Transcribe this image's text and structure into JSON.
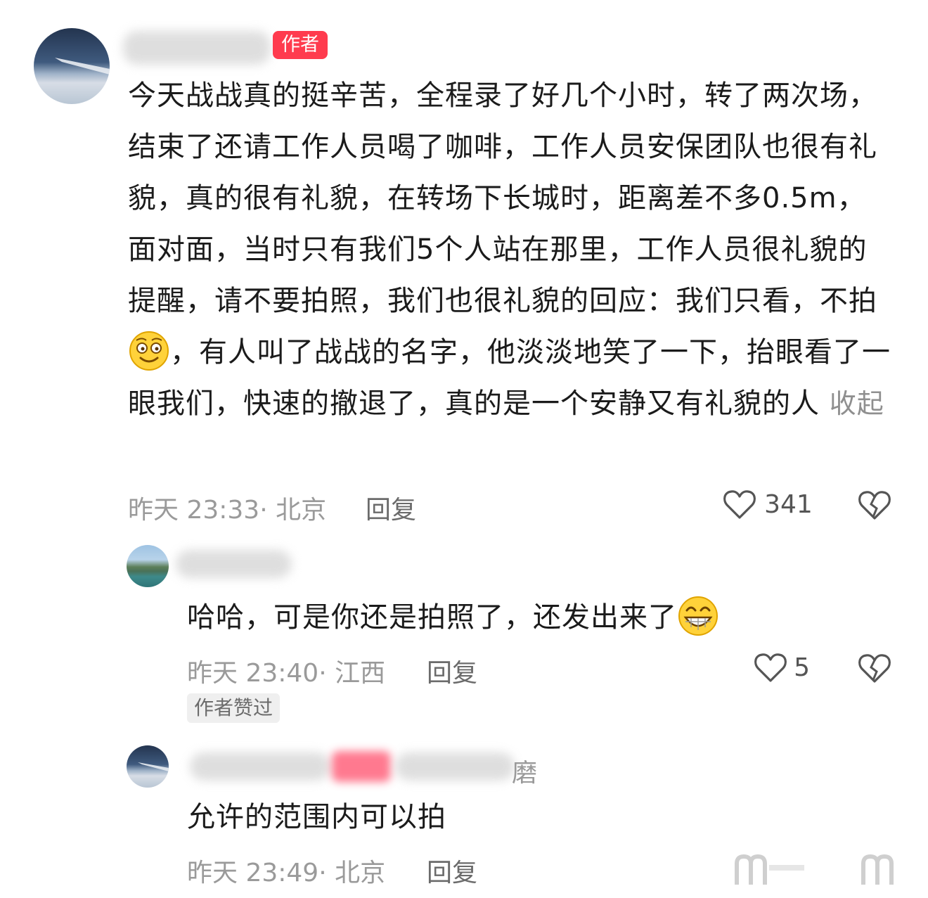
{
  "comment1": {
    "author_tag": "作者",
    "text_part1": "今天战战真的挺辛苦，全程录了好几个小时，转了两次场，结束了还请工作人员喝了咖啡，工作人员安保团队也很有礼貌，真的很有礼貌，在转场下长城时，距离差不多0.5m，面对面，当时只有我们5个人站在那里，工作人员很礼貌的提醒，请不要拍照，我们也很礼貌的回应：我们只看，不拍",
    "emoji1": "smiling-face-emoji",
    "text_part2": "，有人叫了战战的名字，他淡淡地笑了一下，抬眼看了一眼我们，快速的撤退了，真的是一个安静又有礼貌的人",
    "collapse": "收起",
    "meta": "昨天 23:33· 北京",
    "reply": "回复",
    "likes": "341"
  },
  "reply1": {
    "text": "哈哈，可是你还是拍照了，还发出来了",
    "emoji": "grinning-face-emoji",
    "meta": "昨天 23:40· 江西",
    "reply": "回复",
    "likes": "5",
    "badge": "作者赞过"
  },
  "reply2": {
    "name_tail": "磨",
    "text": "允许的范围内可以拍",
    "meta": "昨天 23:49· 北京",
    "reply": "回复"
  },
  "icons": {
    "like": "heart-outline-icon",
    "dislike": "broken-heart-icon",
    "watermark": "weibo-watermark-icon"
  },
  "colors": {
    "author_tag": "#ff3b4e",
    "meta_text": "#9a9a9a",
    "main_text": "#1b1b1b"
  }
}
